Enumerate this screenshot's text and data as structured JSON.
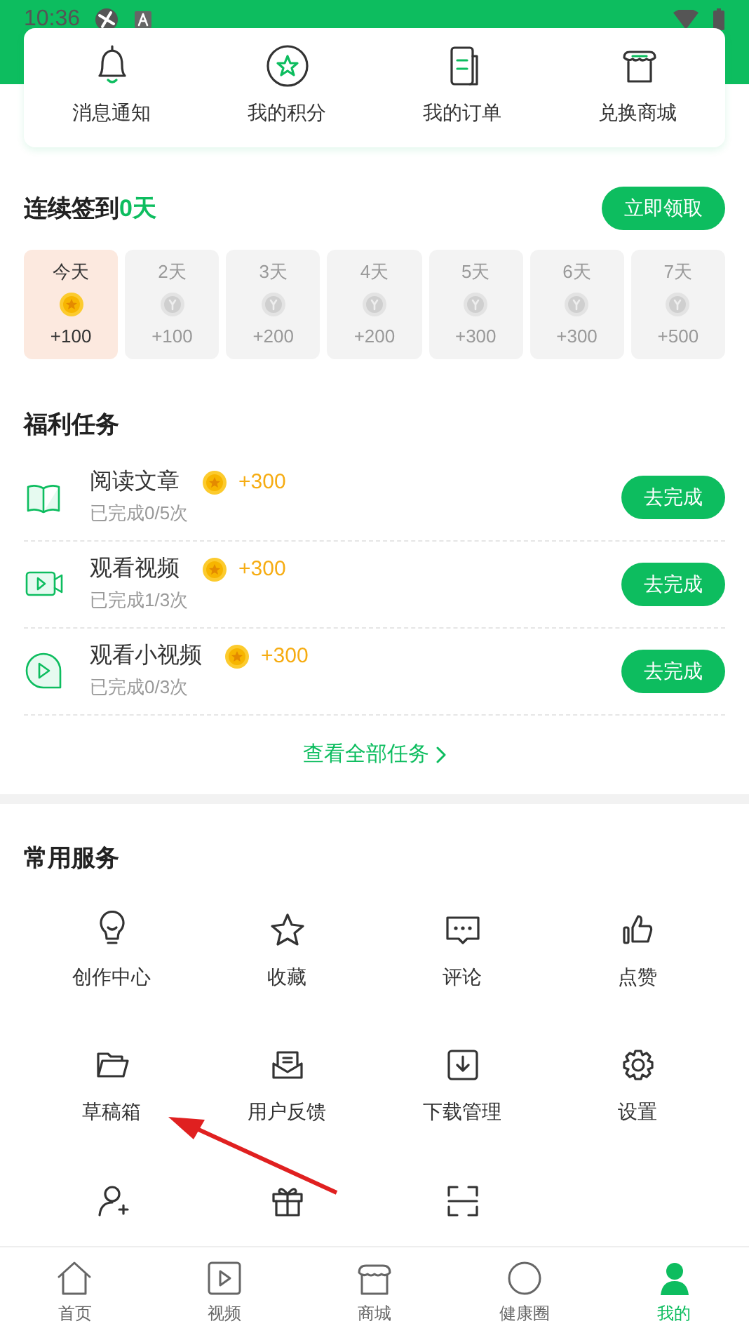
{
  "status_bar": {
    "time": "10:36"
  },
  "shortcuts": [
    {
      "label": "消息通知"
    },
    {
      "label": "我的积分"
    },
    {
      "label": "我的订单"
    },
    {
      "label": "兑换商城"
    }
  ],
  "checkin": {
    "title": "连续签到",
    "count": "0天",
    "button": "立即领取",
    "days": [
      {
        "label": "今天",
        "reward": "+100",
        "selected": true
      },
      {
        "label": "2天",
        "reward": "+100",
        "selected": false
      },
      {
        "label": "3天",
        "reward": "+200",
        "selected": false
      },
      {
        "label": "4天",
        "reward": "+200",
        "selected": false
      },
      {
        "label": "5天",
        "reward": "+300",
        "selected": false
      },
      {
        "label": "6天",
        "reward": "+300",
        "selected": false
      },
      {
        "label": "7天",
        "reward": "+500",
        "selected": false
      }
    ]
  },
  "tasks": {
    "title": "福利任务",
    "items": [
      {
        "kind": "book",
        "name": "阅读文章",
        "reward": "+300",
        "progress": "已完成0/5次",
        "button": "去完成"
      },
      {
        "kind": "video",
        "name": "观看视频",
        "reward": "+300",
        "progress": "已完成1/3次",
        "button": "去完成"
      },
      {
        "kind": "clip",
        "name": "观看小视频",
        "reward": "+300",
        "progress": "已完成0/3次",
        "button": "去完成"
      }
    ],
    "more": "查看全部任务"
  },
  "services": {
    "title": "常用服务",
    "items": [
      {
        "label": "创作中心"
      },
      {
        "label": "收藏"
      },
      {
        "label": "评论"
      },
      {
        "label": "点赞"
      },
      {
        "label": "草稿箱"
      },
      {
        "label": "用户反馈"
      },
      {
        "label": "下载管理"
      },
      {
        "label": "设置"
      }
    ]
  },
  "bottom_nav": [
    {
      "label": "首页",
      "selected": false
    },
    {
      "label": "视频",
      "selected": false
    },
    {
      "label": "商城",
      "selected": false
    },
    {
      "label": "健康圈",
      "selected": false
    },
    {
      "label": "我的",
      "selected": true
    }
  ]
}
